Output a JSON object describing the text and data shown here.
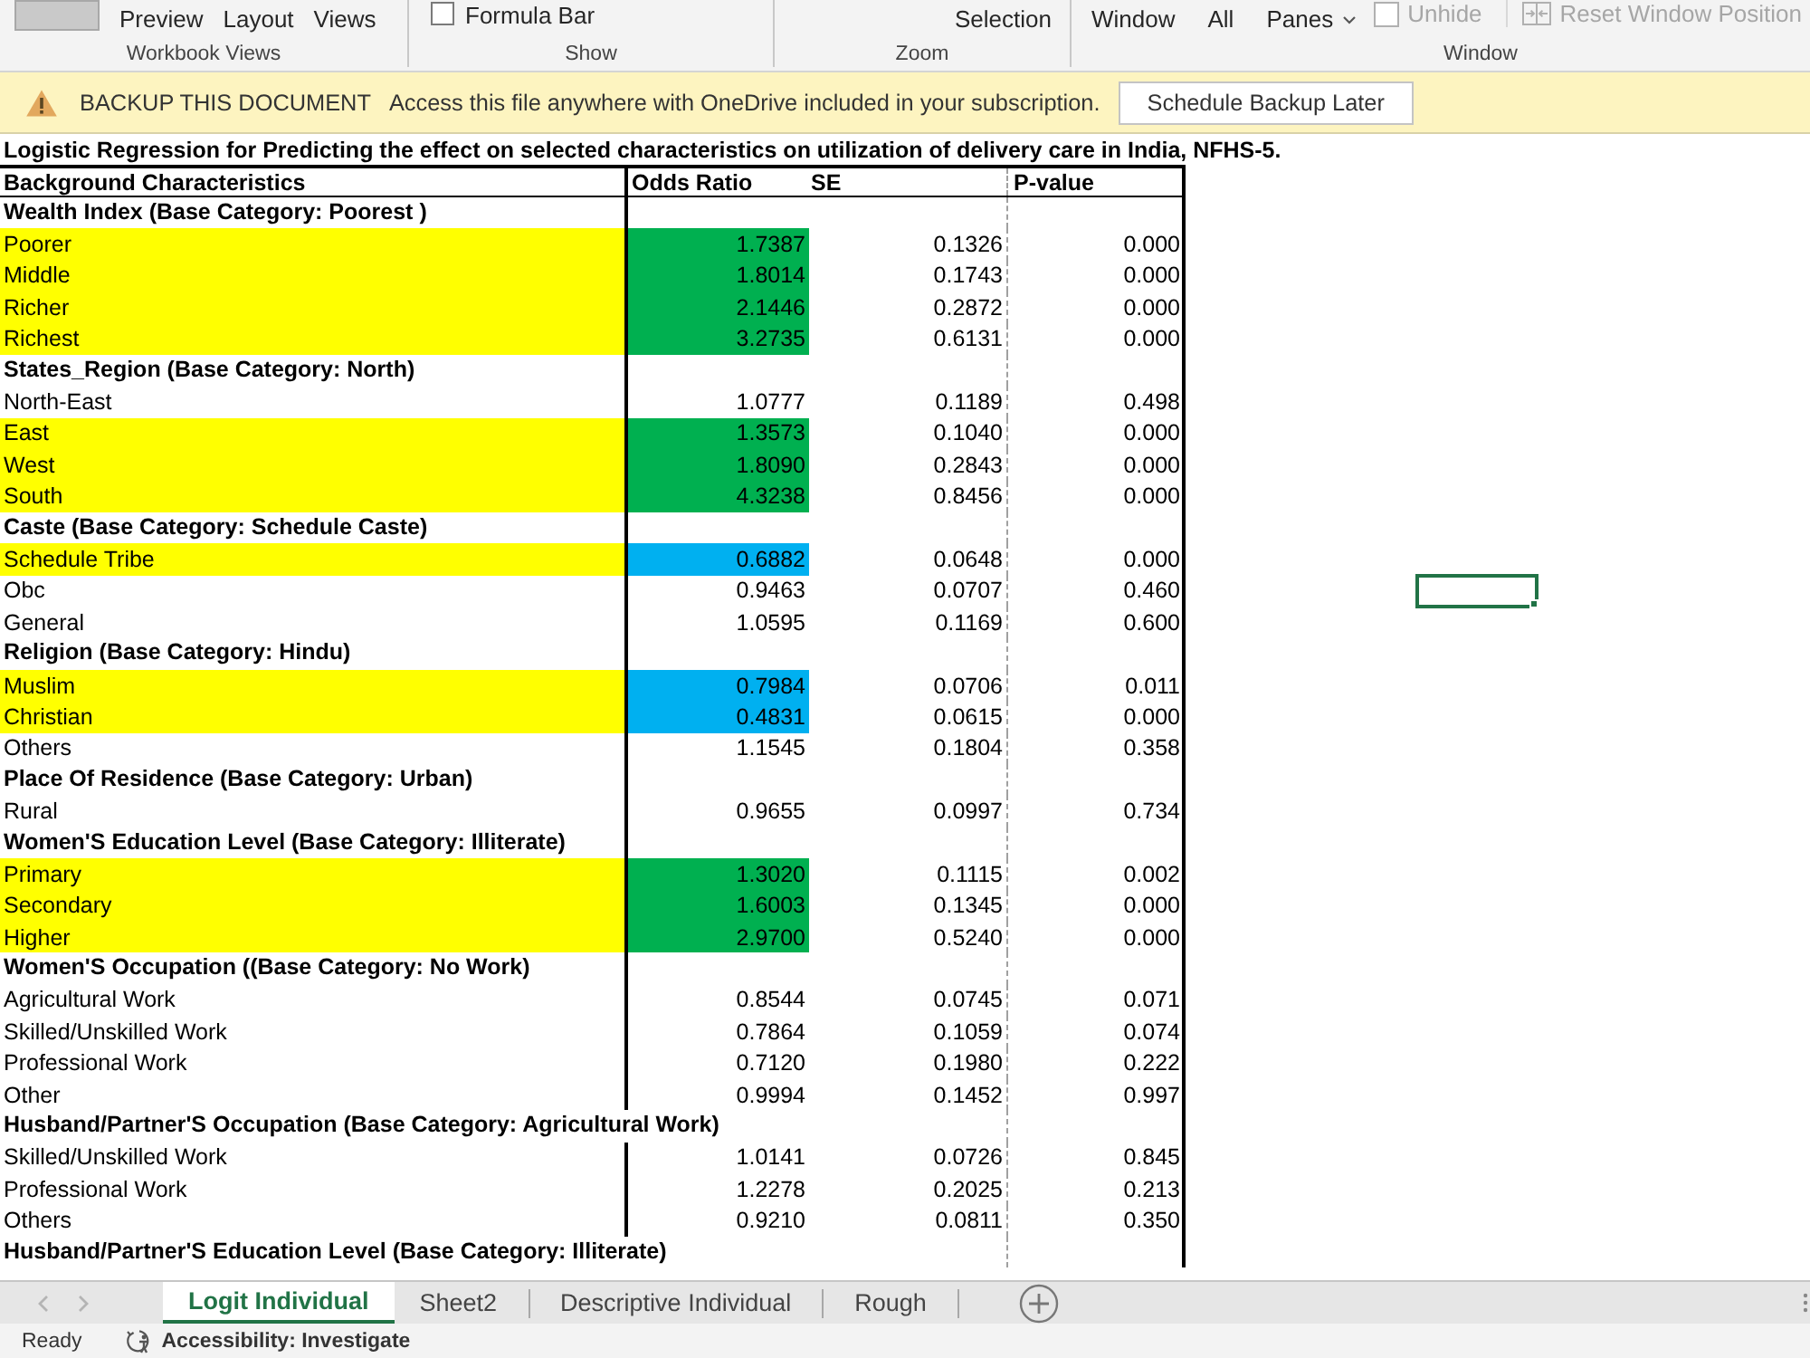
{
  "ribbon": {
    "groups": [
      {
        "label": "Workbook Views",
        "items": [
          {
            "kind": "tile",
            "disabled": false
          },
          {
            "kind": "text",
            "label": "Preview",
            "disabled": false
          },
          {
            "kind": "text",
            "label": "Layout",
            "disabled": false
          },
          {
            "kind": "text",
            "label": "Views",
            "disabled": false
          }
        ]
      },
      {
        "label": "Show",
        "items": [
          {
            "kind": "check",
            "label": "Formula Bar",
            "checked": false,
            "disabled": false
          }
        ]
      },
      {
        "label": "Zoom",
        "items": [
          {
            "kind": "text",
            "label": "Selection",
            "disabled": false
          }
        ]
      },
      {
        "label": "Window",
        "items": [
          {
            "kind": "text",
            "label": "Window",
            "disabled": false
          },
          {
            "kind": "text",
            "label": "All",
            "disabled": false
          },
          {
            "kind": "menu",
            "label": "Panes",
            "disabled": false
          },
          {
            "kind": "boxed",
            "label": "Unhide",
            "disabled": true
          },
          {
            "kind": "split",
            "label": "Reset Window Position",
            "disabled": true
          }
        ]
      }
    ]
  },
  "banner": {
    "title": "BACKUP THIS DOCUMENT",
    "message": "Access this file anywhere with OneDrive included in your subscription.",
    "button": "Schedule Backup Later"
  },
  "sheet": {
    "title": "Logistic Regression for Predicting the effect on selected characteristics on utilization of delivery care in India, NFHS-5.",
    "columns": [
      "Background Characteristics",
      "Odds Ratio",
      "SE",
      "P-value"
    ],
    "rows": [
      {
        "kind": "heading",
        "label": "Wealth Index (Base Category: Poorest )"
      },
      {
        "kind": "data",
        "label": "Poorer",
        "odds_ratio": "1.7387",
        "se": "0.1326",
        "p_value": "0.000",
        "highlighted": true,
        "color": "#00b050"
      },
      {
        "kind": "data",
        "label": "Middle",
        "odds_ratio": "1.8014",
        "se": "0.1743",
        "p_value": "0.000",
        "highlighted": true,
        "color": "#00b050"
      },
      {
        "kind": "data",
        "label": "Richer",
        "odds_ratio": "2.1446",
        "se": "0.2872",
        "p_value": "0.000",
        "highlighted": true,
        "color": "#00b050"
      },
      {
        "kind": "data",
        "label": "Richest",
        "odds_ratio": "3.2735",
        "se": "0.6131",
        "p_value": "0.000",
        "highlighted": true,
        "color": "#00b050"
      },
      {
        "kind": "heading",
        "label": "States_Region (Base Category: North)"
      },
      {
        "kind": "data",
        "label": "North-East",
        "odds_ratio": "1.0777",
        "se": "0.1189",
        "p_value": "0.498",
        "highlighted": false
      },
      {
        "kind": "data",
        "label": "East",
        "odds_ratio": "1.3573",
        "se": "0.1040",
        "p_value": "0.000",
        "highlighted": true,
        "color": "#00b050"
      },
      {
        "kind": "data",
        "label": "West",
        "odds_ratio": "1.8090",
        "se": "0.2843",
        "p_value": "0.000",
        "highlighted": true,
        "color": "#00b050"
      },
      {
        "kind": "data",
        "label": "South",
        "odds_ratio": "4.3238",
        "se": "0.8456",
        "p_value": "0.000",
        "highlighted": true,
        "color": "#00b050"
      },
      {
        "kind": "heading",
        "label": "Caste (Base Category: Schedule Caste)"
      },
      {
        "kind": "data",
        "label": "Schedule Tribe",
        "odds_ratio": "0.6882",
        "se": "0.0648",
        "p_value": "0.000",
        "highlighted": true,
        "color": "#00b0f0"
      },
      {
        "kind": "data",
        "label": "Obc",
        "odds_ratio": "0.9463",
        "se": "0.0707",
        "p_value": "0.460",
        "highlighted": false
      },
      {
        "kind": "data",
        "label": "General",
        "odds_ratio": "1.0595",
        "se": "0.1169",
        "p_value": "0.600",
        "highlighted": false
      },
      {
        "kind": "heading",
        "label": "Religion (Base Category: Hindu)"
      },
      {
        "kind": "data",
        "label": "Muslim",
        "odds_ratio": "0.7984",
        "se": "0.0706",
        "p_value": "0.011",
        "highlighted": true,
        "color": "#00b0f0"
      },
      {
        "kind": "data",
        "label": "Christian",
        "odds_ratio": "0.4831",
        "se": "0.0615",
        "p_value": "0.000",
        "highlighted": true,
        "color": "#00b0f0"
      },
      {
        "kind": "data",
        "label": "Others",
        "odds_ratio": "1.1545",
        "se": "0.1804",
        "p_value": "0.358",
        "highlighted": false
      },
      {
        "kind": "heading",
        "label": "Place Of Residence (Base Category: Urban)"
      },
      {
        "kind": "data",
        "label": "Rural",
        "odds_ratio": "0.9655",
        "se": "0.0997",
        "p_value": "0.734",
        "highlighted": false
      },
      {
        "kind": "heading",
        "label": "Women'S Education Level (Base Category: Illiterate)"
      },
      {
        "kind": "data",
        "label": "Primary",
        "odds_ratio": "1.3020",
        "se": "0.1115",
        "p_value": "0.002",
        "highlighted": true,
        "color": "#00b050"
      },
      {
        "kind": "data",
        "label": "Secondary",
        "odds_ratio": "1.6003",
        "se": "0.1345",
        "p_value": "0.000",
        "highlighted": true,
        "color": "#00b050"
      },
      {
        "kind": "data",
        "label": "Higher",
        "odds_ratio": "2.9700",
        "se": "0.5240",
        "p_value": "0.000",
        "highlighted": true,
        "color": "#00b050"
      },
      {
        "kind": "heading",
        "label": "Women'S Occupation ((Base Category: No Work)"
      },
      {
        "kind": "data",
        "label": "Agricultural Work",
        "odds_ratio": "0.8544",
        "se": "0.0745",
        "p_value": "0.071",
        "highlighted": false
      },
      {
        "kind": "data",
        "label": "Skilled/Unskilled Work",
        "odds_ratio": "0.7864",
        "se": "0.1059",
        "p_value": "0.074",
        "highlighted": false
      },
      {
        "kind": "data",
        "label": "Professional Work",
        "odds_ratio": "0.7120",
        "se": "0.1980",
        "p_value": "0.222",
        "highlighted": false
      },
      {
        "kind": "data",
        "label": "Other",
        "odds_ratio": "0.9994",
        "se": "0.1452",
        "p_value": "0.997",
        "highlighted": false
      },
      {
        "kind": "heading",
        "label": "Husband/Partner'S Occupation (Base Category: Agricultural Work)"
      },
      {
        "kind": "data",
        "label": "Skilled/Unskilled Work",
        "odds_ratio": "1.0141",
        "se": "0.0726",
        "p_value": "0.845",
        "highlighted": false
      },
      {
        "kind": "data",
        "label": "Professional Work",
        "odds_ratio": "1.2278",
        "se": "0.2025",
        "p_value": "0.213",
        "highlighted": false
      },
      {
        "kind": "data",
        "label": "Others",
        "odds_ratio": "0.9210",
        "se": "0.0811",
        "p_value": "0.350",
        "highlighted": false
      },
      {
        "kind": "heading",
        "label": "Husband/Partner'S Education Level (Base Category: Illiterate)"
      }
    ]
  },
  "tabs": [
    {
      "label": "Logit Individual",
      "selected": true
    },
    {
      "label": "Sheet2",
      "selected": false
    },
    {
      "label": "Descriptive Individual",
      "selected": false
    },
    {
      "label": "Rough",
      "selected": false
    }
  ],
  "status_bar": {
    "mode": "Ready",
    "accessibility": "Accessibility: Investigate"
  }
}
